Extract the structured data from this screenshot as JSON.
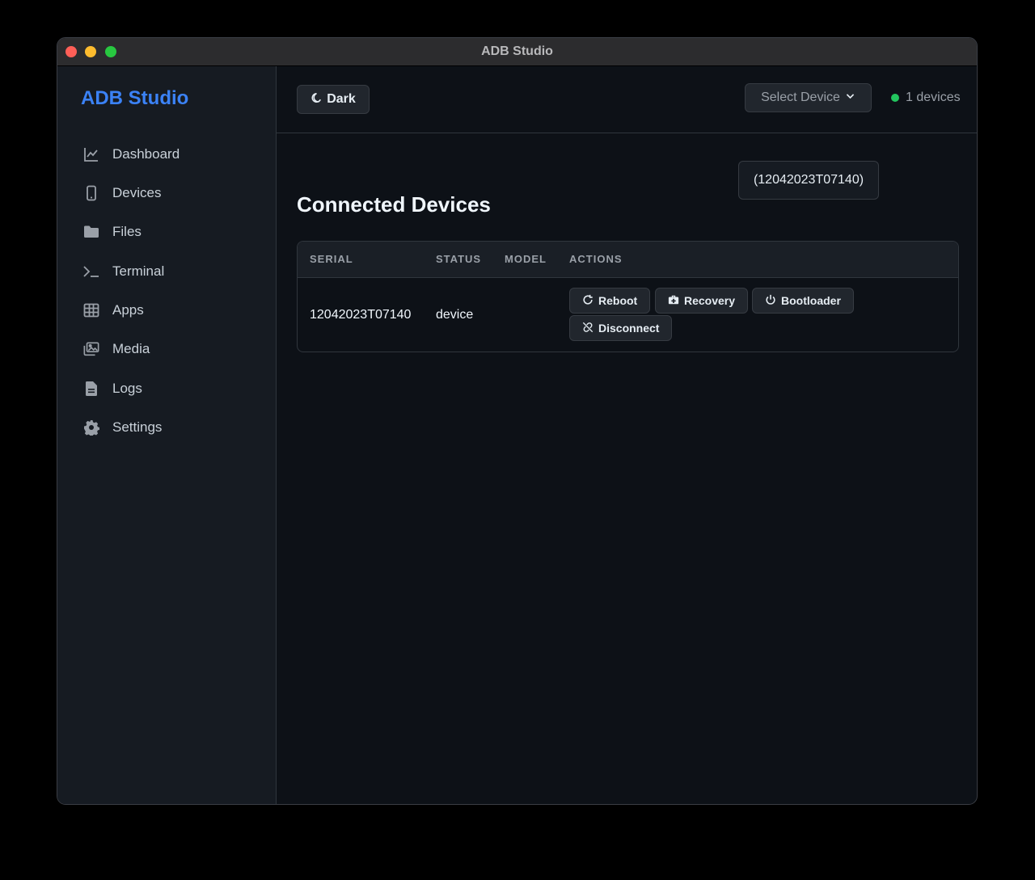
{
  "window": {
    "title": "ADB Studio"
  },
  "sidebar": {
    "brand": "ADB Studio",
    "items": [
      {
        "label": "Dashboard",
        "icon": "chart-line-icon"
      },
      {
        "label": "Devices",
        "icon": "mobile-icon"
      },
      {
        "label": "Files",
        "icon": "folder-icon"
      },
      {
        "label": "Terminal",
        "icon": "terminal-icon"
      },
      {
        "label": "Apps",
        "icon": "grid-icon"
      },
      {
        "label": "Media",
        "icon": "images-icon"
      },
      {
        "label": "Logs",
        "icon": "file-icon"
      },
      {
        "label": "Settings",
        "icon": "gear-icon"
      }
    ]
  },
  "topbar": {
    "theme_label": "Dark",
    "device_select_label": "Select Device",
    "device_count": "1 devices",
    "dropdown_option": "(12042023T07140)"
  },
  "main": {
    "heading": "Connected Devices",
    "columns": [
      "SERIAL",
      "STATUS",
      "MODEL",
      "ACTIONS"
    ],
    "rows": [
      {
        "serial": "12042023T07140",
        "status": "device",
        "model": "",
        "actions": [
          "Reboot",
          "Recovery",
          "Bootloader",
          "Disconnect"
        ]
      }
    ]
  },
  "colors": {
    "accent": "#3b82f6",
    "status_ok": "#22c55e",
    "background": "#0d1117",
    "sidebar": "#161b22"
  }
}
